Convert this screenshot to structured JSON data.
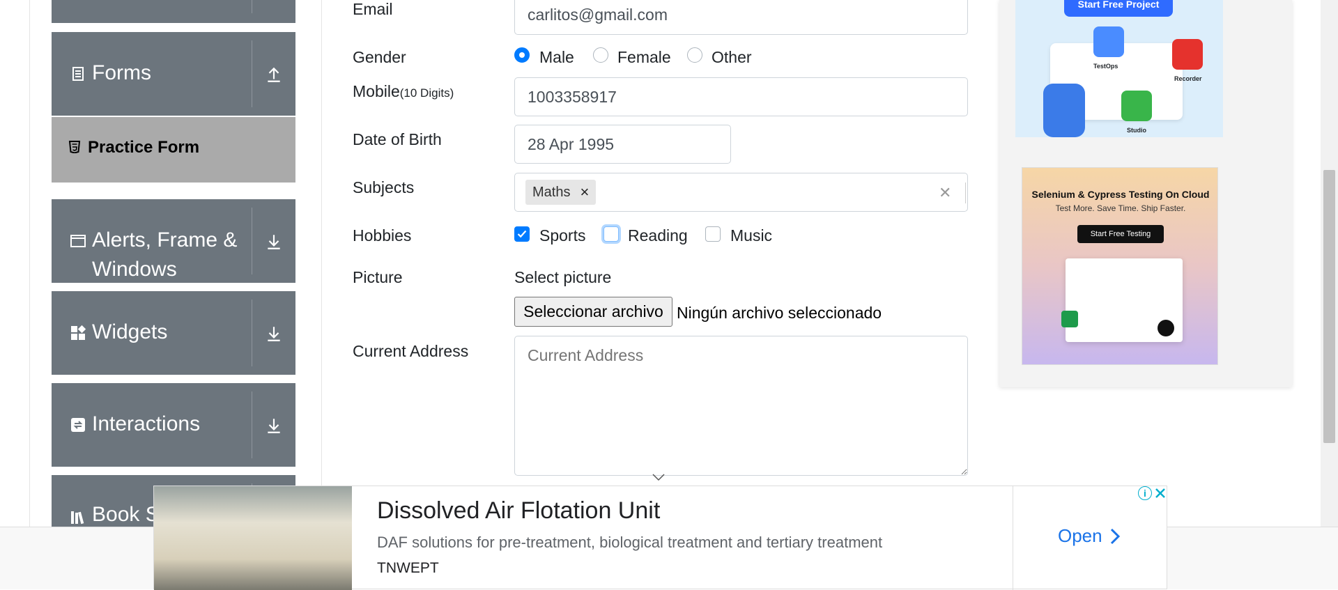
{
  "sidebar": {
    "groups": [
      {
        "label": "Forms",
        "arrow": "up"
      },
      {
        "label": "Alerts, Frame &",
        "label2": "Windows",
        "arrow": "down"
      },
      {
        "label": "Widgets",
        "arrow": "down"
      },
      {
        "label": "Interactions",
        "arrow": "down"
      },
      {
        "label": "Book S",
        "arrow": "down"
      }
    ],
    "active_item": "Practice Form"
  },
  "form": {
    "email": {
      "label": "Email",
      "value": "carlitos@gmail.com"
    },
    "gender": {
      "label": "Gender",
      "options": [
        "Male",
        "Female",
        "Other"
      ],
      "selected": "Male"
    },
    "mobile": {
      "label": "Mobile",
      "label_hint": "(10 Digits)",
      "value": "1003358917"
    },
    "dob": {
      "label": "Date of Birth",
      "value": "28 Apr 1995"
    },
    "subjects": {
      "label": "Subjects",
      "chips": [
        "Maths"
      ],
      "remove_glyph": "×",
      "clear_glyph": "✕"
    },
    "hobbies": {
      "label": "Hobbies",
      "options": [
        "Sports",
        "Reading",
        "Music"
      ],
      "checked": [
        "Sports"
      ]
    },
    "picture": {
      "label": "Picture",
      "select_text": "Select picture",
      "button": "Seleccionar archivo",
      "status": "Ningún archivo seleccionado"
    },
    "address": {
      "label": "Current Address",
      "placeholder": "Current Address"
    }
  },
  "ads": {
    "ad1": {
      "cta": "Start Free Project",
      "tags": [
        "TestOps",
        "Recorder",
        "Studio"
      ]
    },
    "ad2": {
      "title": "Selenium & Cypress Testing On Cloud",
      "subtitle": "Test More. Save Time. Ship Faster.",
      "cta": "Start Free Testing"
    }
  },
  "banner": {
    "title": "Dissolved Air Flotation Unit",
    "description": "DAF solutions for pre-treatment, biological treatment and tertiary treatment",
    "brand": "TNWEPT",
    "open_label": "Open"
  },
  "colors": {
    "sidebar": "#6c757d",
    "active": "#aaaaaa",
    "accent": "#007bff",
    "link": "#1a73e8"
  }
}
